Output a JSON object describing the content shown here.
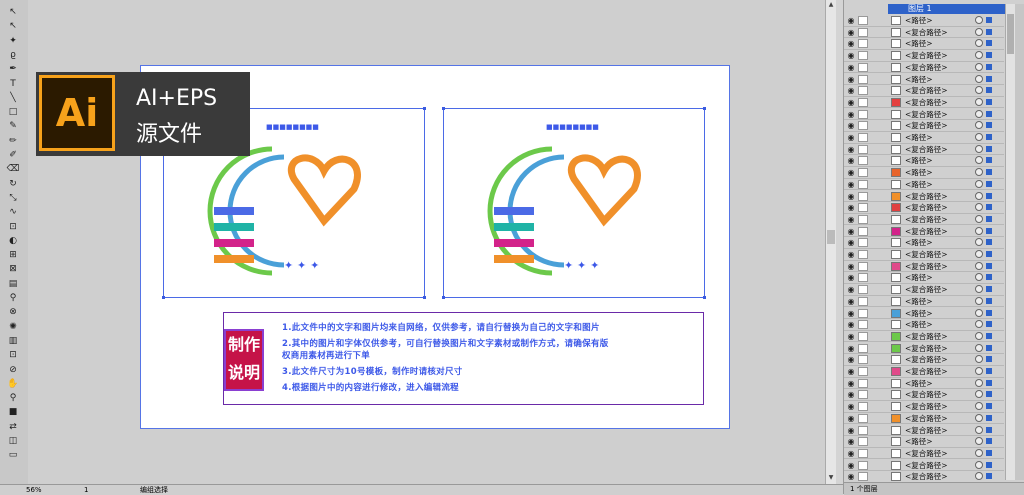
{
  "toolbar": {
    "tools": [
      {
        "name": "selection-tool",
        "glyph": "↖"
      },
      {
        "name": "direct-selection-tool",
        "glyph": "↖"
      },
      {
        "name": "magic-wand-tool",
        "glyph": "✦"
      },
      {
        "name": "lasso-tool",
        "glyph": "ϱ"
      },
      {
        "name": "pen-tool",
        "glyph": "✒"
      },
      {
        "name": "type-tool",
        "glyph": "T"
      },
      {
        "name": "line-tool",
        "glyph": "╲"
      },
      {
        "name": "rectangle-tool",
        "glyph": "□"
      },
      {
        "name": "paintbrush-tool",
        "glyph": "✎"
      },
      {
        "name": "pencil-tool",
        "glyph": "✏"
      },
      {
        "name": "blob-brush-tool",
        "glyph": "✐"
      },
      {
        "name": "eraser-tool",
        "glyph": "⌫"
      },
      {
        "name": "rotate-tool",
        "glyph": "↻"
      },
      {
        "name": "scale-tool",
        "glyph": "⤡"
      },
      {
        "name": "warp-tool",
        "glyph": "∿"
      },
      {
        "name": "free-transform-tool",
        "glyph": "⊡"
      },
      {
        "name": "shape-builder-tool",
        "glyph": "◐"
      },
      {
        "name": "perspective-grid-tool",
        "glyph": "⊞"
      },
      {
        "name": "mesh-tool",
        "glyph": "⊠"
      },
      {
        "name": "gradient-tool",
        "glyph": "▤"
      },
      {
        "name": "eyedropper-tool",
        "glyph": "⚲"
      },
      {
        "name": "blend-tool",
        "glyph": "⊗"
      },
      {
        "name": "symbol-sprayer-tool",
        "glyph": "✺"
      },
      {
        "name": "column-graph-tool",
        "glyph": "▥"
      },
      {
        "name": "artboard-tool",
        "glyph": "⊡"
      },
      {
        "name": "slice-tool",
        "glyph": "⊘"
      },
      {
        "name": "hand-tool",
        "glyph": "✋"
      },
      {
        "name": "zoom-tool",
        "glyph": "⚲"
      },
      {
        "name": "fill-stroke-swatch",
        "glyph": "■"
      },
      {
        "name": "swap-fill-stroke",
        "glyph": "⇄"
      },
      {
        "name": "drawing-mode",
        "glyph": "◫"
      },
      {
        "name": "screen-mode",
        "glyph": "▭"
      }
    ]
  },
  "badge": {
    "logo_text": "Ai",
    "line1": "AI+EPS",
    "line2": "源文件",
    "accent_color": "#f7a21b"
  },
  "artboard": {
    "stamp_text": "制作说明",
    "instructions": [
      "1.此文件中的文字和图片均来自网络，仅供参考，请自行替换为自己的文字和图片",
      "2.其中的图片和字体仅供参考，可自行替换图片和文字素材或制作方式，请确保有版",
      "权商用素材再进行下单",
      "3.此文件尺寸为10号模板，制作时请核对尺寸",
      "4.根据图片中的内容进行修改，进入编辑流程"
    ],
    "colors": {
      "instruction_text": "#3d59e8",
      "stamp_bg": "#c51348",
      "frame": "#4b6ae6",
      "orange": "#f0902a",
      "green": "#6cc94a"
    }
  },
  "layers": {
    "layer_name": "图层 1",
    "rows": [
      "<路径>",
      "<复合路径>",
      "<路径>",
      "<复合路径>",
      "<复合路径>",
      "<路径>",
      "<复合路径>",
      "<复合路径>",
      "<复合路径>",
      "<复合路径>",
      "<路径>",
      "<复合路径>",
      "<路径>",
      "<路径>",
      "<路径>",
      "<复合路径>",
      "<复合路径>",
      "<复合路径>",
      "<复合路径>",
      "<路径>",
      "<复合路径>",
      "<复合路径>",
      "<路径>",
      "<复合路径>",
      "<路径>",
      "<路径>",
      "<路径>",
      "<复合路径>",
      "<复合路径>",
      "<复合路径>",
      "<复合路径>",
      "<路径>",
      "<复合路径>",
      "<复合路径>",
      "<复合路径>",
      "<复合路径>",
      "<路径>",
      "<复合路径>",
      "<复合路径>",
      "<复合路径>"
    ],
    "footer": "1 个图层"
  },
  "status": {
    "zoom": "56%",
    "page": "1",
    "tool_name": "编组选择"
  }
}
